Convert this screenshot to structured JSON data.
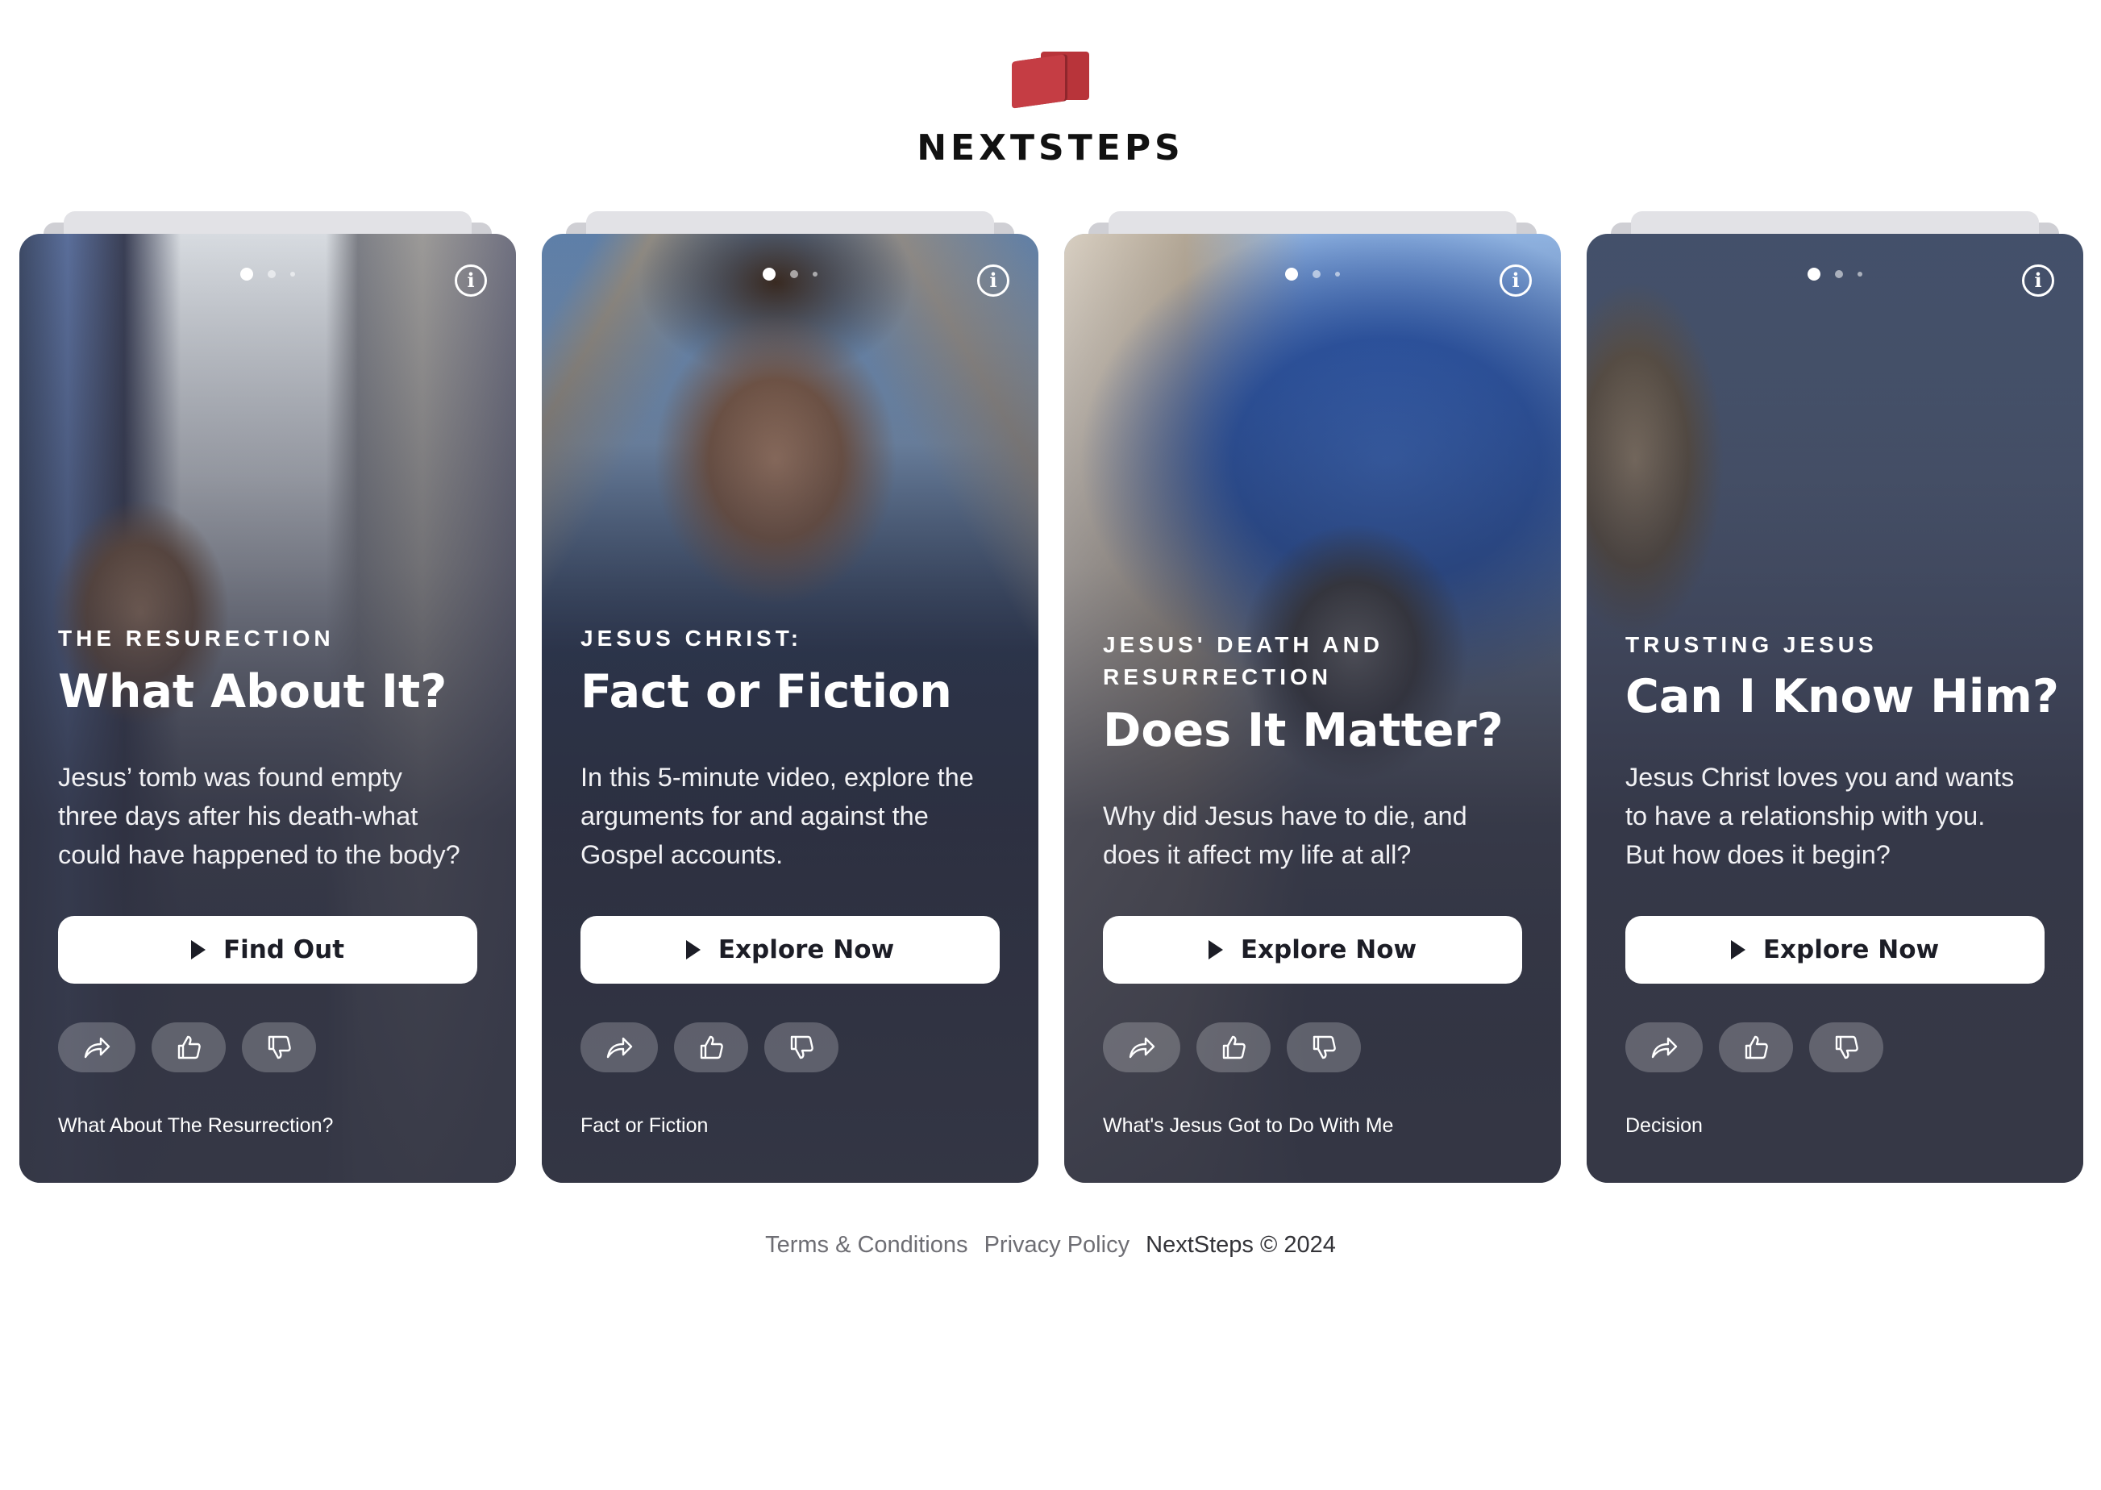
{
  "brand": {
    "name": "NEXTSTEPS",
    "colors": {
      "primary": "#c53d44",
      "dark": "#8f262c"
    }
  },
  "cards": [
    {
      "eyebrow": "THE RESURECTION",
      "title": "What About It?",
      "description": [
        "Jesus’ tomb was found empty",
        "three days after his death-what",
        "could have happened to the body?"
      ],
      "cta": "Find Out",
      "footer": "What About The Resurrection?",
      "icons": [
        "share-icon",
        "thumbs-up-icon",
        "thumbs-down-icon",
        "info-icon",
        "play-icon"
      ]
    },
    {
      "eyebrow": "JESUS CHRIST:",
      "title": "Fact or Fiction",
      "description": [
        "In this 5-minute video, explore the",
        "arguments for and against the",
        "Gospel accounts."
      ],
      "cta": "Explore Now",
      "footer": "Fact or Fiction"
    },
    {
      "eyebrow": "JESUS' DEATH AND RESURRECTION",
      "title": "Does It Matter?",
      "description": [
        "Why did Jesus have to die, and",
        "does it affect my life at all?"
      ],
      "cta": "Explore Now",
      "footer": "What's Jesus Got to Do With Me"
    },
    {
      "eyebrow": "TRUSTING JESUS",
      "title": "Can I Know Him?",
      "description": [
        "Jesus Christ loves you and wants",
        "to have a relationship with you.",
        "But how does it begin?"
      ],
      "cta": "Explore Now",
      "footer": "Decision"
    }
  ],
  "footer": {
    "terms": "Terms & Conditions",
    "privacy": "Privacy Policy",
    "copyright": "NextSteps © 2024"
  }
}
